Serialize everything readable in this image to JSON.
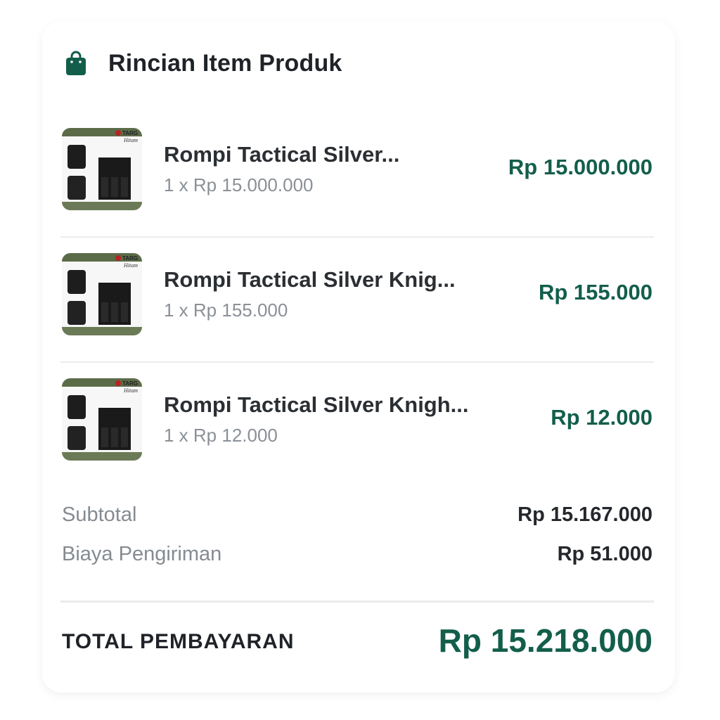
{
  "section": {
    "title": "Rincian Item Produk",
    "icon": "shopping-bag-icon",
    "accent_color": "#135e4b"
  },
  "items": [
    {
      "name": "Rompi Tactical Silver...",
      "qty_line": "1 x Rp 15.000.000",
      "price": "Rp 15.000.000",
      "thumb_label": "Hitam",
      "thumb_logo": "TARG"
    },
    {
      "name": "Rompi Tactical Silver Knig...",
      "qty_line": "1 x Rp 155.000",
      "price": "Rp 155.000",
      "thumb_label": "Hitam",
      "thumb_logo": "TARG"
    },
    {
      "name": "Rompi Tactical Silver Knigh...",
      "qty_line": "1 x Rp 12.000",
      "price": "Rp 12.000",
      "thumb_label": "Hitam",
      "thumb_logo": "TARG"
    }
  ],
  "summary": {
    "subtotal_label": "Subtotal",
    "subtotal_value": "Rp 15.167.000",
    "shipping_label": "Biaya Pengiriman",
    "shipping_value": "Rp 51.000"
  },
  "total": {
    "label": "TOTAL PEMBAYARAN",
    "value": "Rp 15.218.000"
  }
}
